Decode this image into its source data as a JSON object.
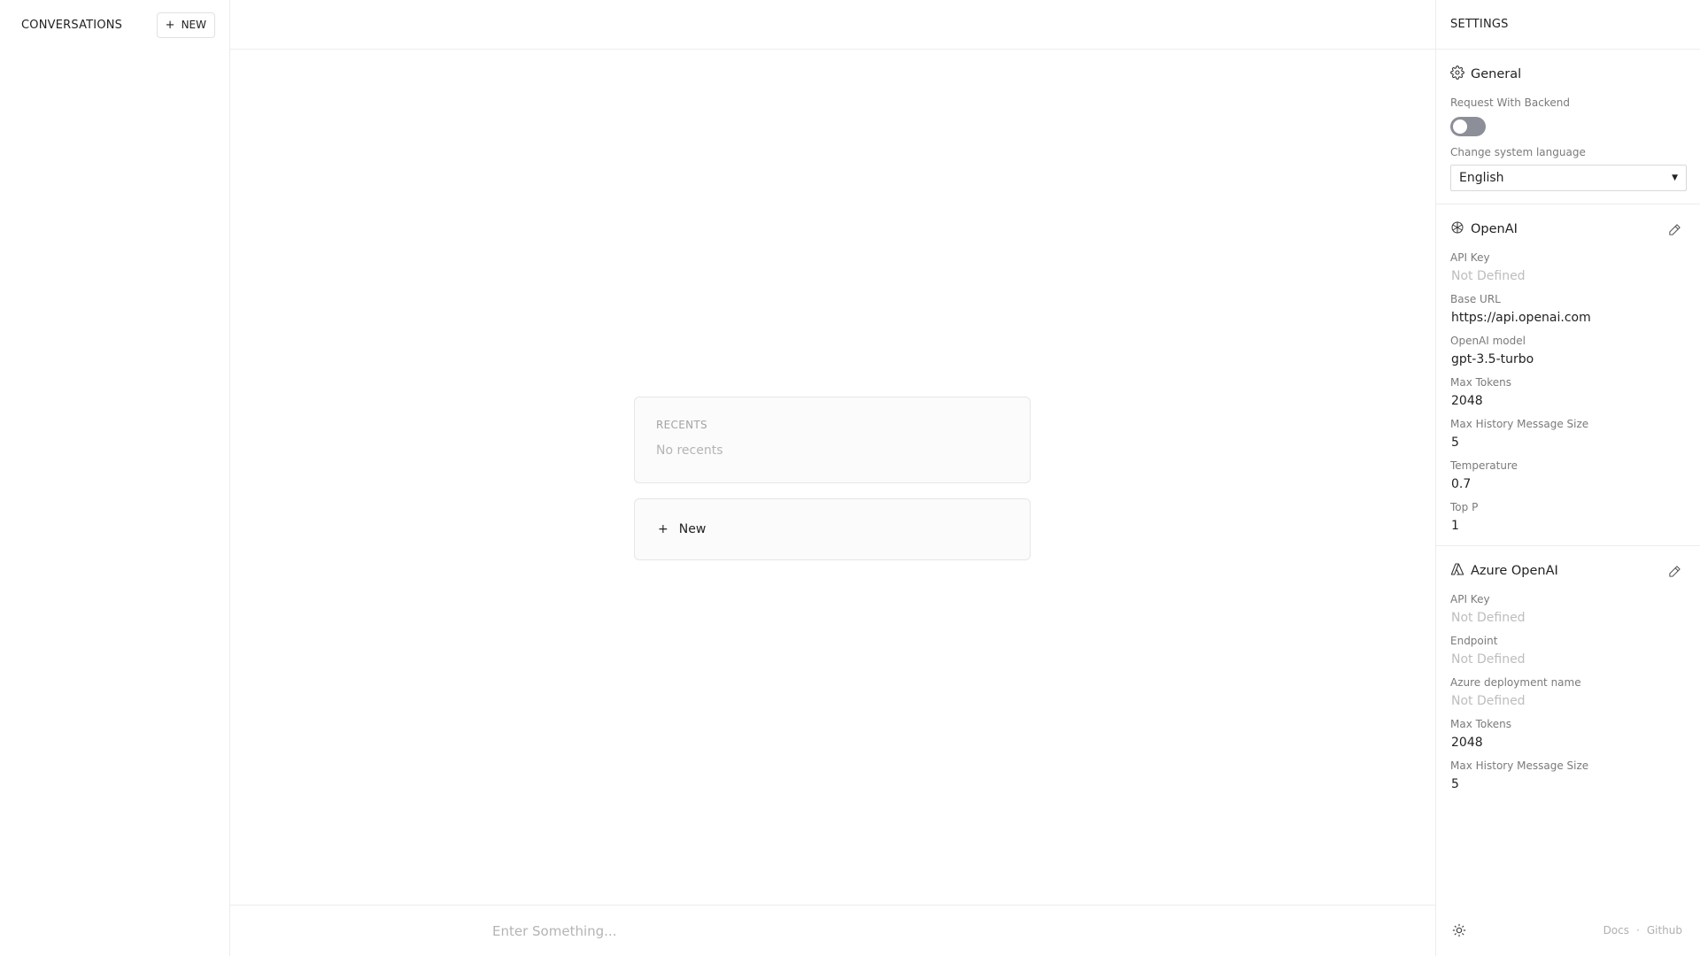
{
  "sidebar": {
    "title": "CONVERSATIONS",
    "new_button_label": "NEW"
  },
  "main": {
    "recents_title": "RECENTS",
    "recents_empty": "No recents",
    "new_label": "New",
    "input_placeholder": "Enter Something..."
  },
  "settings": {
    "title": "SETTINGS",
    "general": {
      "title": "General",
      "request_backend_label": "Request With Backend",
      "request_backend_enabled": false,
      "language_label": "Change system language",
      "language_value": "English"
    },
    "openai": {
      "title": "OpenAI",
      "fields": [
        {
          "label": "API Key",
          "value": "Not Defined",
          "muted": true
        },
        {
          "label": "Base URL",
          "value": "https://api.openai.com",
          "muted": false
        },
        {
          "label": "OpenAI model",
          "value": "gpt-3.5-turbo",
          "muted": false
        },
        {
          "label": "Max Tokens",
          "value": "2048",
          "muted": false
        },
        {
          "label": "Max History Message Size",
          "value": "5",
          "muted": false
        },
        {
          "label": "Temperature",
          "value": "0.7",
          "muted": false
        },
        {
          "label": "Top P",
          "value": "1",
          "muted": false
        }
      ]
    },
    "azure": {
      "title": "Azure OpenAI",
      "fields": [
        {
          "label": "API Key",
          "value": "Not Defined",
          "muted": true
        },
        {
          "label": "Endpoint",
          "value": "Not Defined",
          "muted": true
        },
        {
          "label": "Azure deployment name",
          "value": "Not Defined",
          "muted": true
        },
        {
          "label": "Max Tokens",
          "value": "2048",
          "muted": false
        },
        {
          "label": "Max History Message Size",
          "value": "5",
          "muted": false
        }
      ]
    },
    "footer": {
      "docs_label": "Docs",
      "separator": "·",
      "github_label": "Github"
    }
  },
  "icons": {
    "plus": "plus-icon",
    "gear": "gear-icon",
    "openai": "openai-logo-icon",
    "azure": "azure-logo-icon",
    "edit": "pencil-icon",
    "sun": "sun-icon",
    "caret": "caret-down-icon"
  }
}
